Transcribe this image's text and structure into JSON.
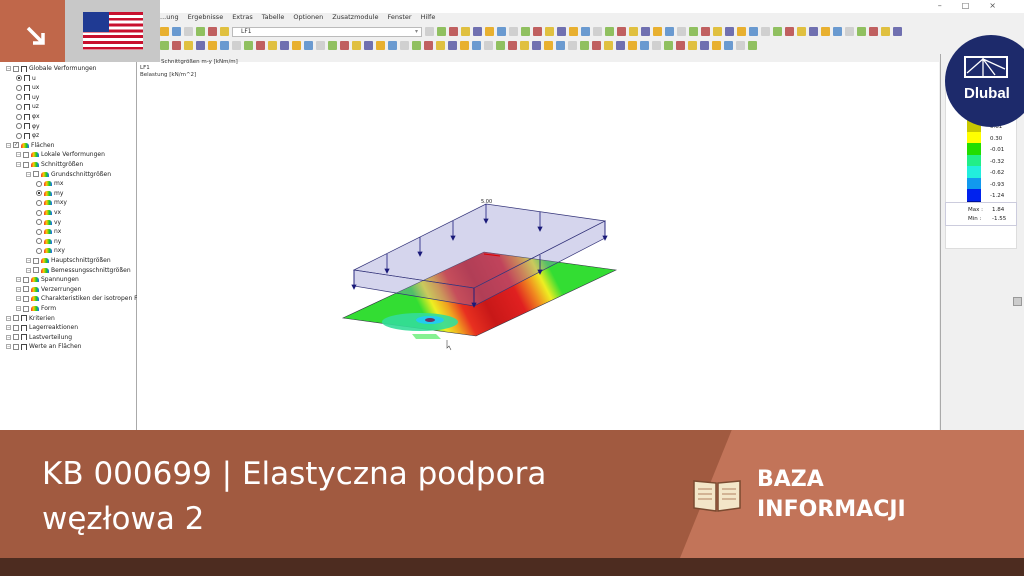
{
  "menu": [
    "...ung",
    "Ergebnisse",
    "Extras",
    "Tabelle",
    "Optionen",
    "Zusatzmodule",
    "Fenster",
    "Hilfe"
  ],
  "toolbar": {
    "loadcase": "LF1"
  },
  "tree": [
    {
      "label": "Globale Verformungen",
      "lvl": 0,
      "type": "cb-g"
    },
    {
      "label": "u",
      "lvl": 1,
      "type": "rb-on-g"
    },
    {
      "label": "ux",
      "lvl": 1,
      "type": "rb-g"
    },
    {
      "label": "uy",
      "lvl": 1,
      "type": "rb-g"
    },
    {
      "label": "uz",
      "lvl": 1,
      "type": "rb-g"
    },
    {
      "label": "φx",
      "lvl": 1,
      "type": "rb-g"
    },
    {
      "label": "φy",
      "lvl": 1,
      "type": "rb-g"
    },
    {
      "label": "φz",
      "lvl": 1,
      "type": "rb-g"
    },
    {
      "label": "Flächen",
      "lvl": 0,
      "type": "cbchk-f"
    },
    {
      "label": "Lokale Verformungen",
      "lvl": 1,
      "type": "pm-f"
    },
    {
      "label": "Schnittgrößen",
      "lvl": 1,
      "type": "pm-f"
    },
    {
      "label": "Grundschnittgrößen",
      "lvl": 2,
      "type": "pm-f"
    },
    {
      "label": "mx",
      "lvl": 3,
      "type": "rb-f"
    },
    {
      "label": "my",
      "lvl": 3,
      "type": "rb-on-f"
    },
    {
      "label": "mxy",
      "lvl": 3,
      "type": "rb-f"
    },
    {
      "label": "vx",
      "lvl": 3,
      "type": "rb-f"
    },
    {
      "label": "vy",
      "lvl": 3,
      "type": "rb-f"
    },
    {
      "label": "nx",
      "lvl": 3,
      "type": "rb-f"
    },
    {
      "label": "ny",
      "lvl": 3,
      "type": "rb-f"
    },
    {
      "label": "nxy",
      "lvl": 3,
      "type": "rb-f"
    },
    {
      "label": "Hauptschnittgrößen",
      "lvl": 2,
      "type": "pm-f"
    },
    {
      "label": "Bemessungsschnittgrößen",
      "lvl": 2,
      "type": "pm-f"
    },
    {
      "label": "Spannungen",
      "lvl": 1,
      "type": "pm-f"
    },
    {
      "label": "Verzerrungen",
      "lvl": 1,
      "type": "pm-f"
    },
    {
      "label": "Charakteristiken der isotropen F",
      "lvl": 1,
      "type": "pm-f"
    },
    {
      "label": "Form",
      "lvl": 1,
      "type": "pm-f"
    },
    {
      "label": "Kriterien",
      "lvl": 0,
      "type": "cb-g"
    },
    {
      "label": "Lagerreaktionen",
      "lvl": 0,
      "type": "cb-g"
    },
    {
      "label": "Lastverteilung",
      "lvl": 0,
      "type": "cb-g"
    },
    {
      "label": "Werte an Flächen",
      "lvl": 0,
      "type": "cb-g"
    }
  ],
  "viewport": {
    "line1": "Schnittgrößen m-y [kNm/m]",
    "line2": "LF1",
    "line3": "Belastung [kN/m^2]",
    "load_value": "5.00"
  },
  "legend": {
    "colors": [
      "#c8c800",
      "#ffff00",
      "#22dd00",
      "#22ee88",
      "#22eedd",
      "#1199ee",
      "#0022ee",
      "#001199"
    ],
    "values": [
      "0.61",
      "0.30",
      "-0.01",
      "-0.32",
      "-0.62",
      "-0.93",
      "-1.24",
      "-1.55"
    ],
    "max_label": "Max :",
    "max": "1.84",
    "min_label": "Min :",
    "min": "-1.55"
  },
  "logo": "Dlubal",
  "banner": {
    "title": "KB 000699 | Elastyczna podpora węzłowa 2",
    "category_line1": "BAZA",
    "category_line2": "INFORMACJI"
  }
}
